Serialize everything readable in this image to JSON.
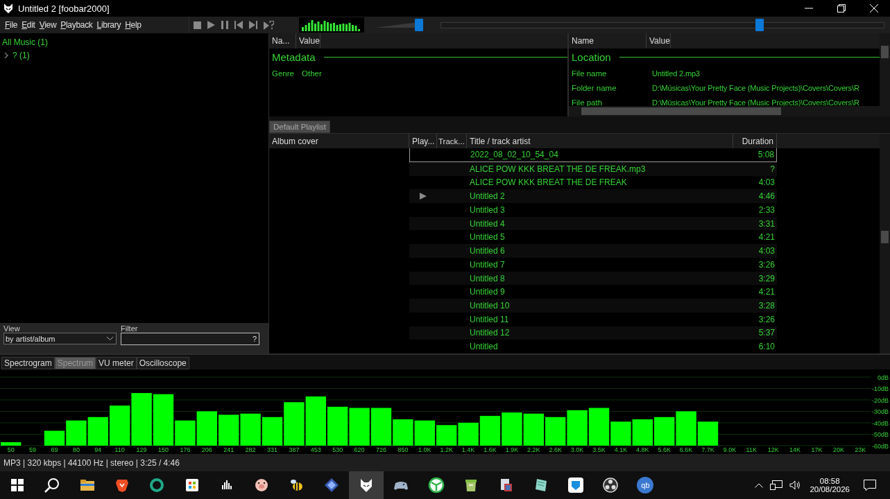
{
  "window": {
    "title": "Untitled 2  [foobar2000]"
  },
  "menu": [
    "File",
    "Edit",
    "View",
    "Playback",
    "Library",
    "Help"
  ],
  "volume": {
    "level": 0.9
  },
  "seekbar": {
    "level": 0.72
  },
  "library": {
    "tree": [
      {
        "label": "All Music (1)",
        "children": [
          {
            "label": "? (1)",
            "expanded": false
          }
        ]
      }
    ]
  },
  "view_filter": {
    "view_label": "View",
    "view_value": "by artist/album",
    "filter_label": "Filter",
    "filter_help": "?"
  },
  "properties_left": {
    "columns": [
      "Na...",
      "Value"
    ],
    "section": "Metadata",
    "rows": [
      {
        "name": "Genre",
        "value": "Other"
      }
    ]
  },
  "properties_right": {
    "columns": [
      "Name",
      "Value"
    ],
    "section": "Location",
    "rows": [
      {
        "name": "File name",
        "value": "Untitled 2.mp3"
      },
      {
        "name": "Folder name",
        "value": "D:\\Músicas\\Your Pretty Face (Music Projects)\\Covers\\Covers\\R"
      },
      {
        "name": "File path",
        "value": "D:\\Músicas\\Your Pretty Face (Music Projects)\\Covers\\Covers\\R"
      }
    ]
  },
  "playlist": {
    "tabs": [
      {
        "label": "Default Playlist",
        "selected": true
      }
    ],
    "columns": [
      "Album cover",
      "Play...",
      "Track...",
      "Title / track artist",
      "Duration"
    ],
    "rows": [
      {
        "title": "2022_08_02_10_54_04",
        "duration": "5:08",
        "playing": false,
        "focused": true
      },
      {
        "title": "ALICE POW KKK BREAT THE DE FREAK.mp3",
        "duration": "?",
        "playing": false,
        "focused": false
      },
      {
        "title": "ALICE POW KKK BREAT THE DE FREAK",
        "duration": "4:03",
        "playing": false,
        "focused": false
      },
      {
        "title": "Untitled 2",
        "duration": "4:46",
        "playing": true,
        "focused": false
      },
      {
        "title": "Untitled 3",
        "duration": "2:33",
        "playing": false,
        "focused": false
      },
      {
        "title": "Untitled 4",
        "duration": "3:31",
        "playing": false,
        "focused": false
      },
      {
        "title": "Untitled 5",
        "duration": "4:21",
        "playing": false,
        "focused": false
      },
      {
        "title": "Untitled 6",
        "duration": "4:03",
        "playing": false,
        "focused": false
      },
      {
        "title": "Untitled 7",
        "duration": "3:26",
        "playing": false,
        "focused": false
      },
      {
        "title": "Untitled 8",
        "duration": "3:29",
        "playing": false,
        "focused": false
      },
      {
        "title": "Untitled 9",
        "duration": "4:21",
        "playing": false,
        "focused": false
      },
      {
        "title": "Untitled 10",
        "duration": "3:28",
        "playing": false,
        "focused": false
      },
      {
        "title": "Untitled 11",
        "duration": "3:26",
        "playing": false,
        "focused": false
      },
      {
        "title": "Untitled 12",
        "duration": "5:37",
        "playing": false,
        "focused": false
      },
      {
        "title": "Untitled",
        "duration": "6:10",
        "playing": false,
        "focused": false
      }
    ]
  },
  "visualization": {
    "tabs": [
      {
        "label": "Spectrogram",
        "selected": false
      },
      {
        "label": "Spectrum",
        "selected": true
      },
      {
        "label": "VU meter",
        "selected": false
      },
      {
        "label": "Oscilloscope",
        "selected": false
      }
    ],
    "spectrum": {
      "frequency_labels": [
        "50",
        "59",
        "69",
        "80",
        "94",
        "110",
        "129",
        "150",
        "176",
        "206",
        "241",
        "282",
        "331",
        "387",
        "453",
        "530",
        "620",
        "726",
        "850",
        "1.0K",
        "1.2K",
        "1.4K",
        "1.6K",
        "1.9K",
        "2.2K",
        "2.6K",
        "3.0K",
        "3.5K",
        "4.1K",
        "4.8K",
        "5.6K",
        "6.6K",
        "7.7K",
        "9.0K",
        "11K",
        "12K",
        "14K",
        "17K",
        "20K",
        "23K"
      ],
      "level_labels": [
        "0dB",
        "-10dB",
        "-20dB",
        "-30dB",
        "-40dB",
        "-50dB",
        "-60dB"
      ]
    }
  },
  "status_bar": "MP3 | 320 kbps | 44100 Hz | stereo | 3:25 / 4:46",
  "taskbar": {
    "apps": [
      {
        "selected": false
      },
      {
        "selected": false
      },
      {
        "selected": false
      },
      {
        "selected": false
      },
      {
        "selected": false
      },
      {
        "selected": false
      },
      {
        "selected": false
      },
      {
        "selected": false
      },
      {
        "selected": true
      },
      {
        "selected": false
      },
      {
        "selected": false
      },
      {
        "selected": false
      },
      {
        "selected": false
      },
      {
        "selected": false
      },
      {
        "selected": false
      },
      {
        "selected": false
      },
      {
        "selected": false,
        "label": "qb"
      }
    ],
    "time": "08:58",
    "date": "20/08/2026"
  }
}
